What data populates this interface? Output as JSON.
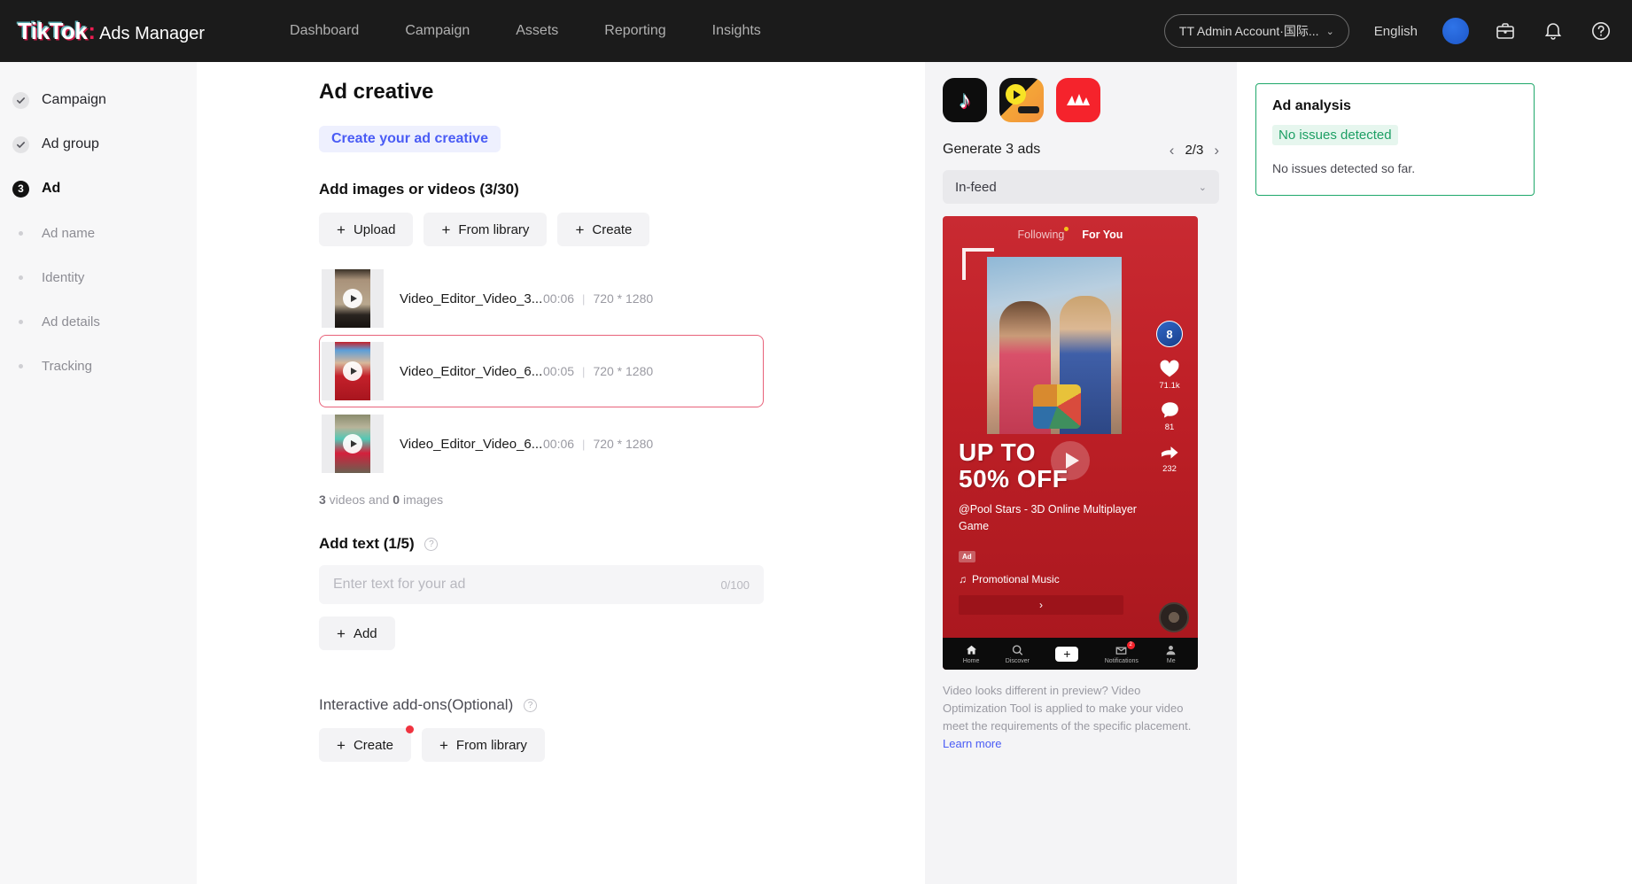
{
  "header": {
    "logo_main": "TikTok",
    "logo_colon": ":",
    "logo_sub": "Ads Manager",
    "nav": [
      {
        "label": "Dashboard"
      },
      {
        "label": "Campaign"
      },
      {
        "label": "Assets"
      },
      {
        "label": "Reporting"
      },
      {
        "label": "Insights"
      }
    ],
    "account": "TT Admin Account·国际...",
    "account_chevron": "⌄",
    "language": "English"
  },
  "sidebar": {
    "steps": [
      {
        "label": "Campaign",
        "state": "done",
        "badge": ""
      },
      {
        "label": "Ad group",
        "state": "done",
        "badge": ""
      },
      {
        "label": "Ad",
        "state": "active",
        "badge": "3"
      }
    ],
    "subitems": [
      {
        "label": "Ad name"
      },
      {
        "label": "Identity"
      },
      {
        "label": "Ad details"
      },
      {
        "label": "Tracking"
      }
    ]
  },
  "main": {
    "page_title": "Ad creative",
    "create_link": "Create your ad creative",
    "media_section_title": "Add images or videos (3/30)",
    "media_buttons": [
      {
        "label": "Upload",
        "plus": "+"
      },
      {
        "label": "From library",
        "plus": "+"
      },
      {
        "label": "Create",
        "plus": "+"
      }
    ],
    "videos": [
      {
        "name": "Video_Editor_Video_3...",
        "duration": "00:06",
        "separator": "|",
        "dimensions": "720 * 1280",
        "selected": false
      },
      {
        "name": "Video_Editor_Video_6...",
        "duration": "00:05",
        "separator": "|",
        "dimensions": "720 * 1280",
        "selected": true
      },
      {
        "name": "Video_Editor_Video_6...",
        "duration": "00:06",
        "separator": "|",
        "dimensions": "720 * 1280",
        "selected": false
      }
    ],
    "summary_count_videos": "3",
    "summary_mid": " videos and ",
    "summary_count_images": "0",
    "summary_end": " images",
    "text_section_title": "Add text (1/5)",
    "text_placeholder": "Enter text for your ad",
    "text_value": "",
    "text_counter": "0/100",
    "add_button": "Add",
    "addons_title": "Interactive add-ons",
    "addons_optional": "(Optional)",
    "addons_buttons": [
      {
        "label": "Create",
        "plus": "+",
        "has_dot": true
      },
      {
        "label": "From library",
        "plus": "+",
        "has_dot": false
      }
    ]
  },
  "preview": {
    "app_icons": [
      {
        "name": "tiktok-app-icon",
        "selected": true
      },
      {
        "name": "yellow-video-app-icon",
        "selected": false
      },
      {
        "name": "red-pangle-app-icon",
        "selected": false
      }
    ],
    "generate_label": "Generate 3 ads",
    "pager_prev": "‹",
    "pager_count": "2/3",
    "pager_next": "›",
    "placement": "In-feed",
    "placement_chevron": "⌄",
    "phone": {
      "tab_following": "Following",
      "tab_foryou": "For You",
      "offer_line1": "UP TO",
      "offer_line2": "50% OFF",
      "caption": "@Pool Stars - 3D Online Multiplayer Game",
      "ad_badge": "Ad",
      "music_note": "♫",
      "music": "Promotional Music",
      "cta": "›",
      "avatar_badge": "8",
      "likes": "71.1k",
      "comments": "81",
      "shares": "232",
      "nav": [
        {
          "label": "Home",
          "icon": "home-icon",
          "badge": ""
        },
        {
          "label": "Discover",
          "icon": "search-icon",
          "badge": ""
        },
        {
          "label": "",
          "icon": "plus-icon",
          "badge": ""
        },
        {
          "label": "Notifications",
          "icon": "inbox-icon",
          "badge": "2"
        },
        {
          "label": "Me",
          "icon": "person-icon",
          "badge": ""
        }
      ]
    },
    "note_text": "Video looks different in preview? Video Optimization Tool is applied to make your video meet the requirements of the specific placement. ",
    "note_link": "Learn more"
  },
  "analysis": {
    "title": "Ad analysis",
    "status": "No issues detected",
    "body": "No issues detected so far.",
    "border_color": "#1fa86a"
  }
}
